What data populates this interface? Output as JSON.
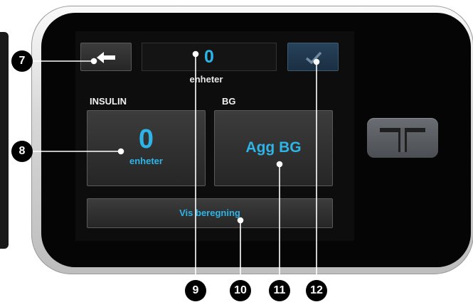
{
  "screen": {
    "amount_value": "0",
    "amount_unit": "enheter",
    "insulin_label": "INSULIN",
    "bg_label": "BG",
    "insulin_value": "0",
    "insulin_unit": "enheter",
    "bg_action": "Agg BG",
    "calc_label": "Vis beregning",
    "icons": {
      "back": "arrow-left-icon",
      "confirm": "checkmark-icon",
      "device_button": "t-logo-icon"
    }
  },
  "callouts": [
    "7",
    "8",
    "9",
    "10",
    "11",
    "12"
  ],
  "colors": {
    "accent": "#2eb4e6",
    "screen_bg": "#0d0d0d",
    "confirm_bg": "#27425a"
  }
}
